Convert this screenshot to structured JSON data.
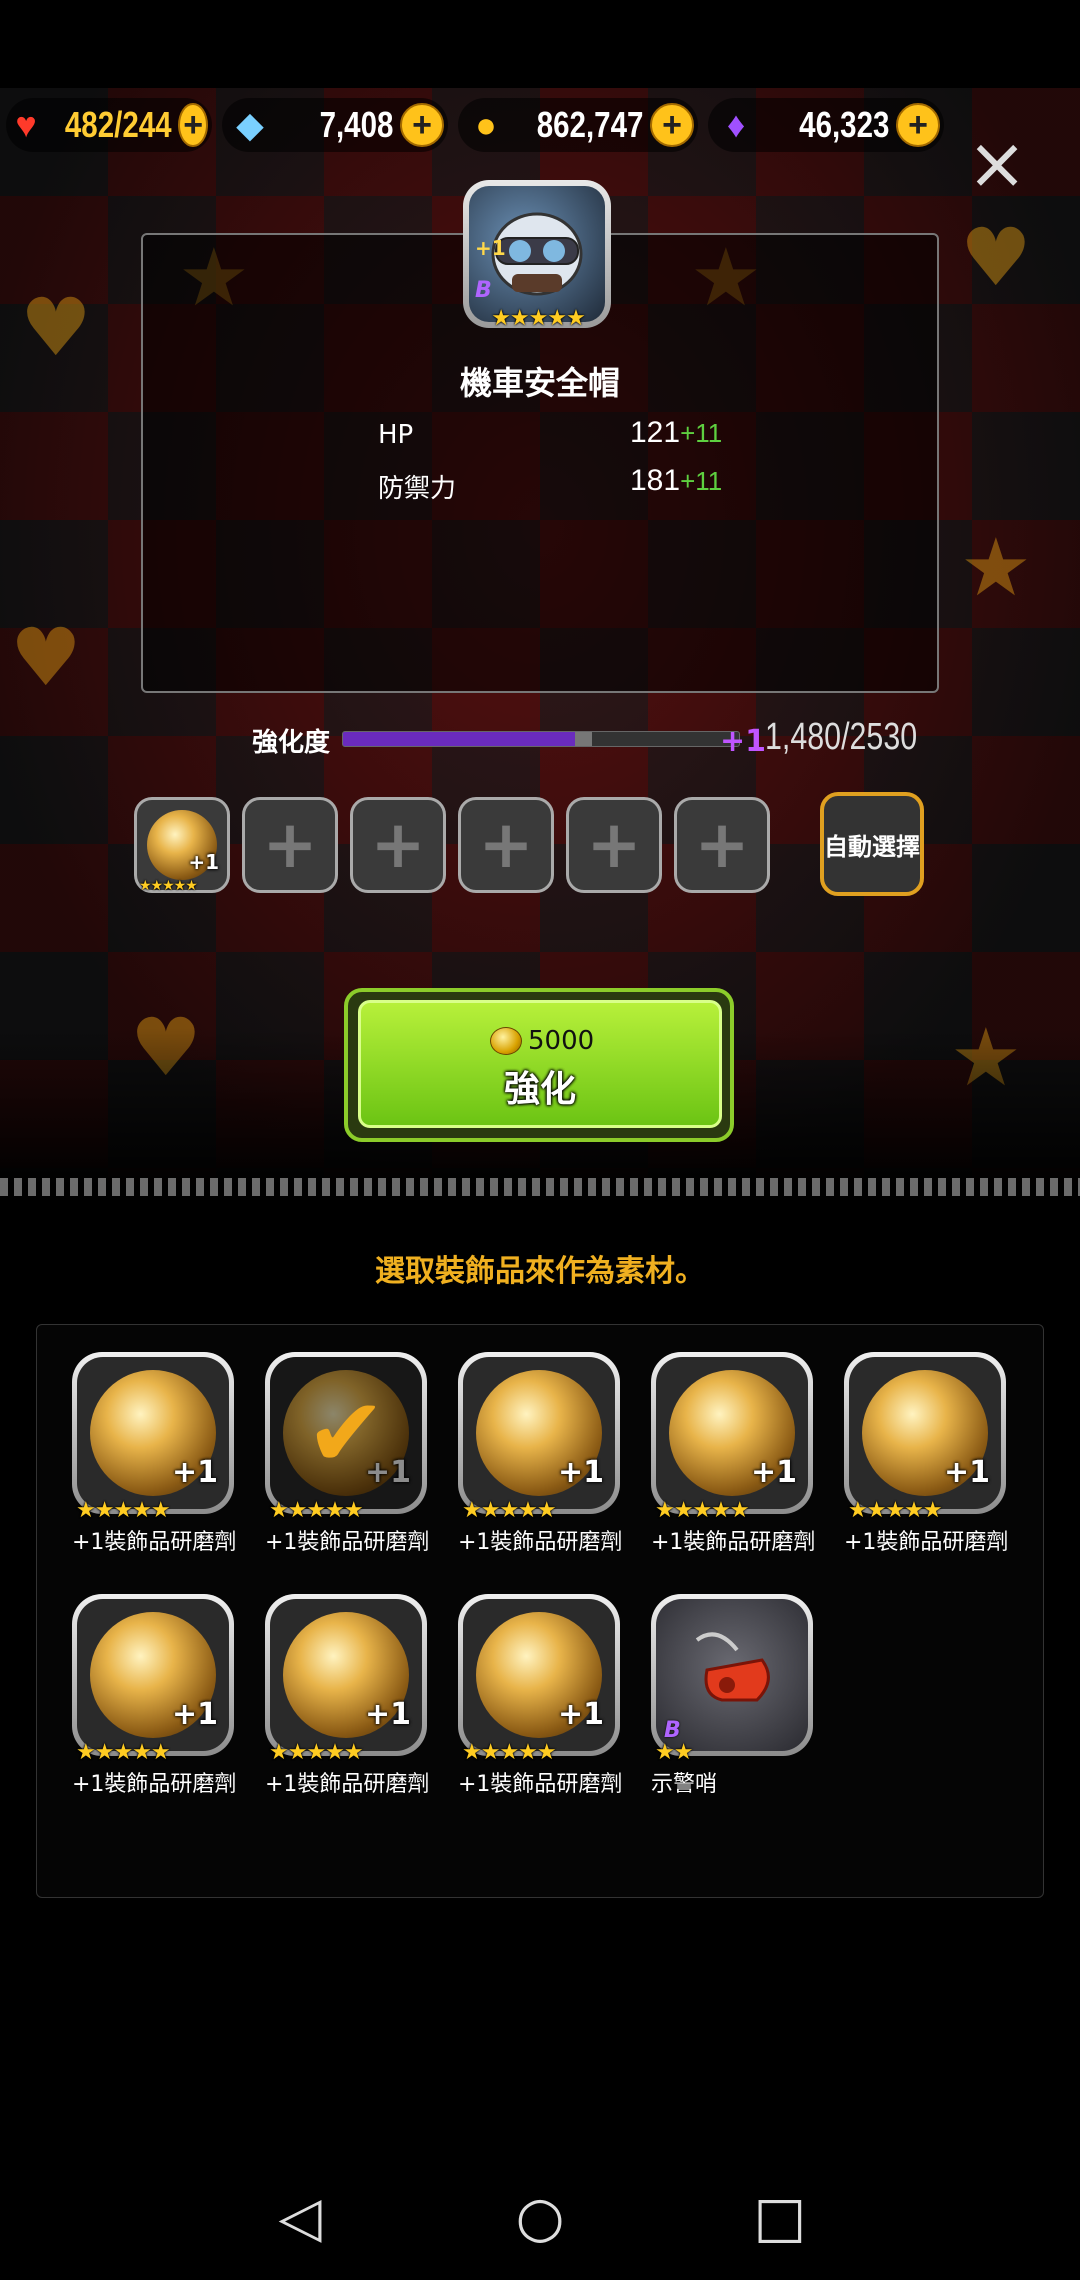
{
  "currencies": [
    {
      "icon": "heart-icon",
      "value": "482/244"
    },
    {
      "icon": "rainbow-gem-icon",
      "value": "7,408"
    },
    {
      "icon": "gold-coin-icon",
      "value": "862,747"
    },
    {
      "icon": "purple-crystal-icon",
      "value": "46,323"
    }
  ],
  "item": {
    "name": "機車安全帽",
    "level_badge": "+1",
    "rank_badge": "B",
    "stars": "★★★★★",
    "stats": [
      {
        "label": "HP",
        "base": "121",
        "bonus": "+11"
      },
      {
        "label": "防禦力",
        "base": "181",
        "bonus": "+11"
      }
    ]
  },
  "enhance": {
    "label": "強化度",
    "progress_fraction": 0.585,
    "preview_fraction": 0.63,
    "plus_level": "+1",
    "count": "1,480/2530"
  },
  "material_slots": {
    "filled": [
      {
        "badge": "+1",
        "stars": "★★★★★"
      }
    ],
    "empty_count": 5,
    "auto_label": "自動選擇"
  },
  "enhance_button": {
    "cost": "5000",
    "label": "強化"
  },
  "hint": "選取裝飾品來作為素材。",
  "inventory": [
    {
      "name": "+1裝飾品研磨劑",
      "stars": "★★★★★",
      "badge": "+1",
      "selected": false,
      "type": "orb"
    },
    {
      "name": "+1裝飾品研磨劑",
      "stars": "★★★★★",
      "badge": "+1",
      "selected": true,
      "type": "orb"
    },
    {
      "name": "+1裝飾品研磨劑",
      "stars": "★★★★★",
      "badge": "+1",
      "selected": false,
      "type": "orb"
    },
    {
      "name": "+1裝飾品研磨劑",
      "stars": "★★★★★",
      "badge": "+1",
      "selected": false,
      "type": "orb"
    },
    {
      "name": "+1裝飾品研磨劑",
      "stars": "★★★★★",
      "badge": "+1",
      "selected": false,
      "type": "orb"
    },
    {
      "name": "+1裝飾品研磨劑",
      "stars": "★★★★★",
      "badge": "+1",
      "selected": false,
      "type": "orb"
    },
    {
      "name": "+1裝飾品研磨劑",
      "stars": "★★★★★",
      "badge": "+1",
      "selected": false,
      "type": "orb"
    },
    {
      "name": "+1裝飾品研磨劑",
      "stars": "★★★★★",
      "badge": "+1",
      "selected": false,
      "type": "orb"
    },
    {
      "name": "示警哨",
      "stars": "★★",
      "badge": "B",
      "selected": false,
      "type": "whistle"
    }
  ],
  "icons": {
    "close": "close-icon",
    "nav_back": "back-icon",
    "nav_home": "home-icon",
    "nav_recent": "recent-apps-icon"
  },
  "colors": {
    "accent_gold": "#f0b020",
    "button_green": "#8fdc24",
    "progress_purple": "#6a2bbd",
    "bonus_green": "#5ed040"
  }
}
